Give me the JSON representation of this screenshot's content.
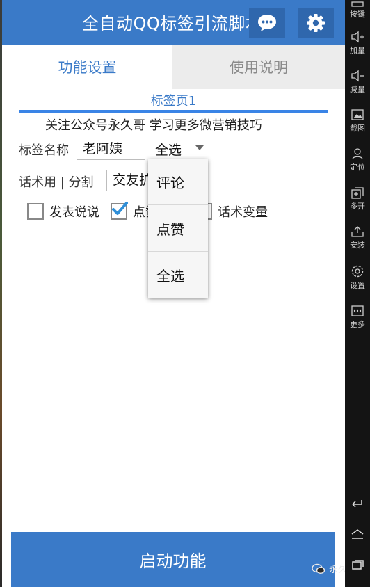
{
  "app": {
    "title": "全自动QQ标签引流脚本",
    "colors": {
      "primary": "#3a7ac8",
      "tab_inactive_bg": "#ececec"
    },
    "tabs": [
      {
        "label": "功能设置",
        "active": true
      },
      {
        "label": "使用说明",
        "active": false
      }
    ],
    "subtab_label": "标签页1",
    "notice": "关注公众号永久哥 学习更多微营销技巧",
    "form": {
      "tag_name_label": "标签名称",
      "tag_name_value": "老阿姨",
      "select_value": "全选",
      "script_label": "话术用 | 分割",
      "script_value": "交友扩",
      "checkboxes": [
        {
          "label": "发表说说",
          "checked": false
        },
        {
          "label": "点赞",
          "checked": true
        },
        {
          "label": "话术变量",
          "checked": false
        }
      ]
    },
    "dropdown_options": [
      "评论",
      "点赞",
      "全选"
    ],
    "start_button": "启动功能",
    "watermark": "永久哥"
  },
  "side_panel": {
    "items": [
      {
        "label": "按键",
        "icon": "keyboard-icon"
      },
      {
        "label": "加量",
        "icon": "volume-up-icon"
      },
      {
        "label": "减量",
        "icon": "volume-down-icon"
      },
      {
        "label": "截图",
        "icon": "screenshot-icon"
      },
      {
        "label": "定位",
        "icon": "location-icon"
      },
      {
        "label": "多开",
        "icon": "multi-open-icon"
      },
      {
        "label": "安装",
        "icon": "install-icon"
      },
      {
        "label": "设置",
        "icon": "settings-icon"
      },
      {
        "label": "更多",
        "icon": "more-icon"
      }
    ],
    "nav": [
      "back-icon",
      "home-icon",
      "recent-apps-icon"
    ]
  }
}
